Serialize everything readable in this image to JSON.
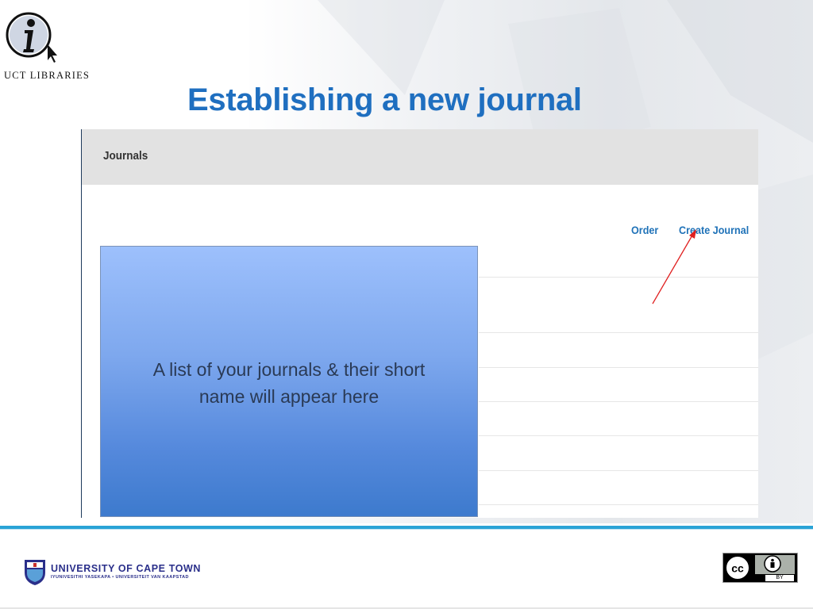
{
  "slide": {
    "title": "Establishing a new journal",
    "logo_caption": "UCT LIBRARIES"
  },
  "panel": {
    "header_label": "Journals",
    "links": {
      "order": "Order",
      "create_journal": "Create Journal"
    }
  },
  "callout": {
    "line1": "A list of your journals & their short",
    "line2": "name will appear here"
  },
  "footer": {
    "university_name": "UNIVERSITY OF CAPE TOWN",
    "university_sub": "IYUNIVESITHI YASEKAPA • UNIVERSITEIT VAN KAAPSTAD",
    "license_label": "BY"
  },
  "colors": {
    "title": "#1f6fc0",
    "link": "#1f72b8",
    "arrow": "#e02020",
    "footer_rule": "#2aa3d6"
  },
  "icons": {
    "logo": "info-cursor-icon",
    "university": "uct-crest-icon",
    "license": "creative-commons-by-icon"
  }
}
